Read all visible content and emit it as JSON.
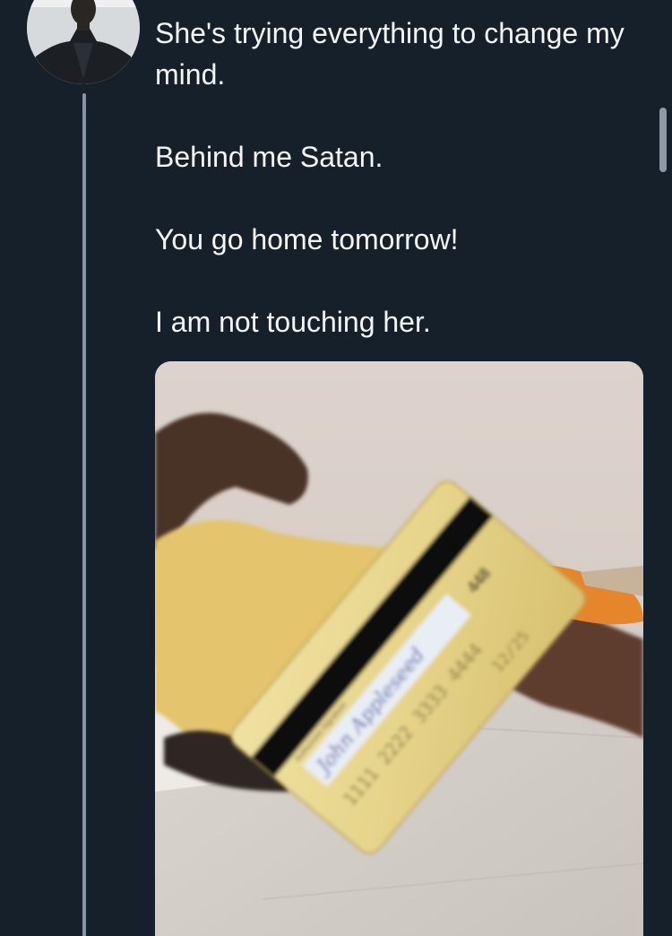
{
  "tweet": {
    "lines": [
      "She's trying everything to change my mind.",
      "Behind me Satan.",
      "You go home tomorrow!",
      "I am not touching her."
    ],
    "media": {
      "card_signature_label": "Authorized Signature",
      "card_signature": "John Appleseed",
      "card_cvv": "448",
      "card_number": "1111 2222 3333 4444",
      "card_expiry": "12/25"
    }
  },
  "colors": {
    "background": "#16202b",
    "text": "#f3f5f7",
    "thread_line": "#8494a6"
  }
}
